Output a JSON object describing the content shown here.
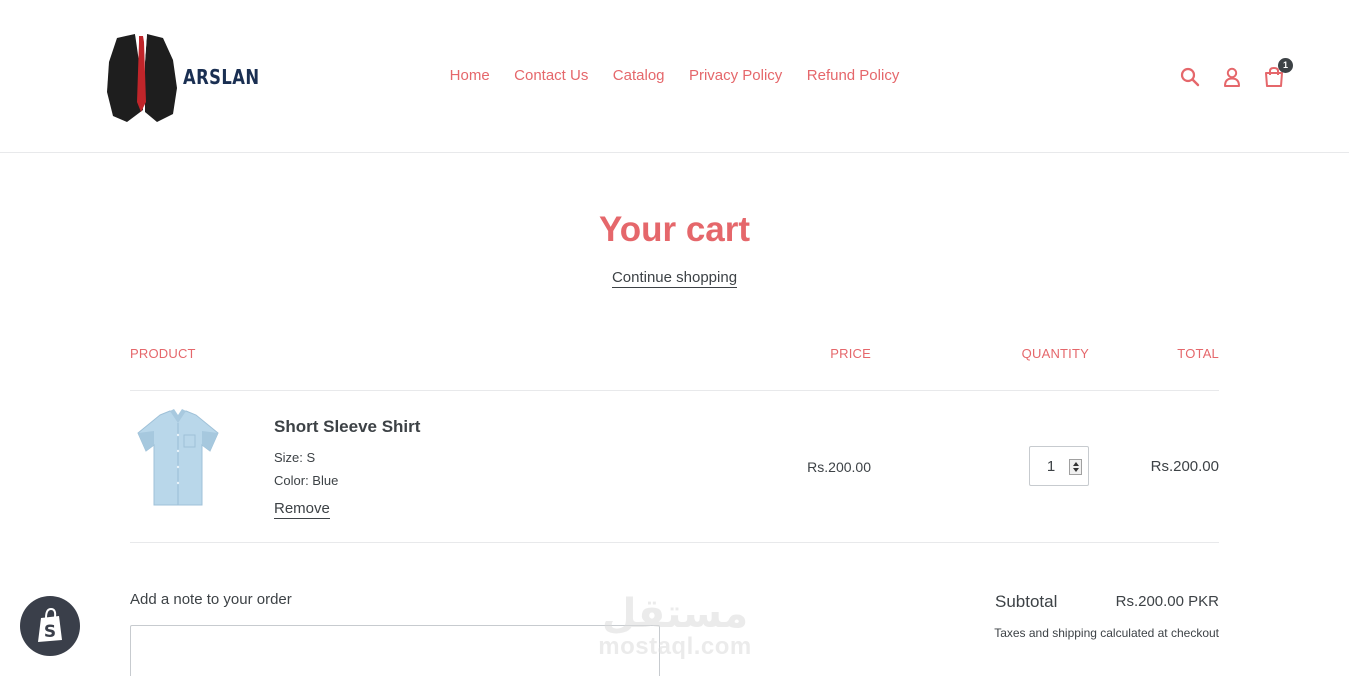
{
  "brand": {
    "name": "ARSLAN"
  },
  "nav": {
    "items": [
      "Home",
      "Contact Us",
      "Catalog",
      "Privacy Policy",
      "Refund Policy"
    ]
  },
  "header_icons": {
    "search": "search-icon",
    "account": "user-icon",
    "cart": "cart-icon",
    "cart_count": "1"
  },
  "page": {
    "title": "Your cart",
    "continue_link": "Continue shopping"
  },
  "table": {
    "headers": {
      "product": "Product",
      "price": "Price",
      "quantity": "Quantity",
      "total": "Total"
    },
    "items": [
      {
        "title": "Short Sleeve Shirt",
        "size": "Size: S",
        "color": "Color: Blue",
        "remove": "Remove",
        "price": "Rs.200.00",
        "quantity": "1",
        "total": "Rs.200.00"
      }
    ]
  },
  "footer": {
    "note_label": "Add a note to your order",
    "subtotal_label": "Subtotal",
    "subtotal_value": "Rs.200.00 PKR",
    "tax_note": "Taxes and shipping calculated at checkout"
  },
  "watermark": {
    "arabic": "مستقل",
    "latin": "mostaql.com"
  },
  "colors": {
    "accent": "#e5676b",
    "text": "#3d4246",
    "border": "#e8e9eb",
    "badge": "#3a3f4a"
  }
}
